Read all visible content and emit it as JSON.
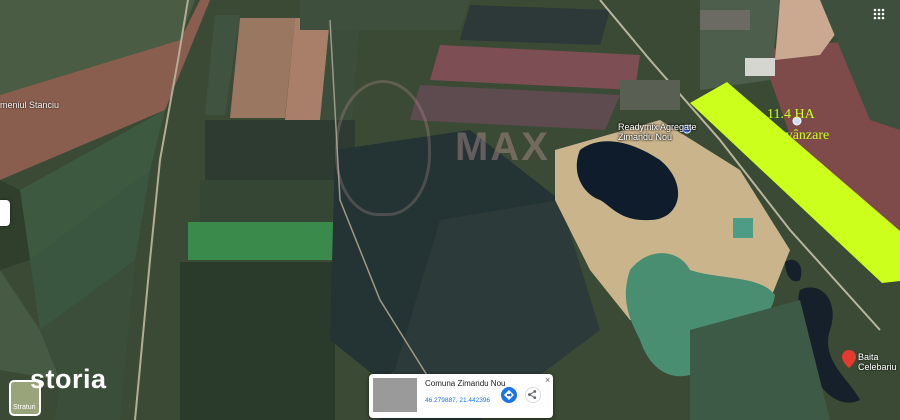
{
  "map": {
    "place_label": "meniul Stanciu",
    "poi_label_line1": "Readymix Agregate",
    "poi_label_line2": "Zimandu Nou",
    "bait_label": "Baita Celebariu",
    "land_label_line1": "11.4 HA",
    "land_label_line2": "de vânzare",
    "watermark": "MAX",
    "highlight_color": "#ccff1c"
  },
  "brand": {
    "name": "storia"
  },
  "layers": {
    "label": "Straturi"
  },
  "info_card": {
    "title": "Comuna Zimandu Nou",
    "coords": "46.279887, 21.442396",
    "close": "×"
  },
  "icons": {
    "directions": "directions-icon",
    "share": "share-icon",
    "apps": "apps-grid-icon",
    "pin": "location-pin-icon",
    "poi": "poi-marker-icon"
  }
}
